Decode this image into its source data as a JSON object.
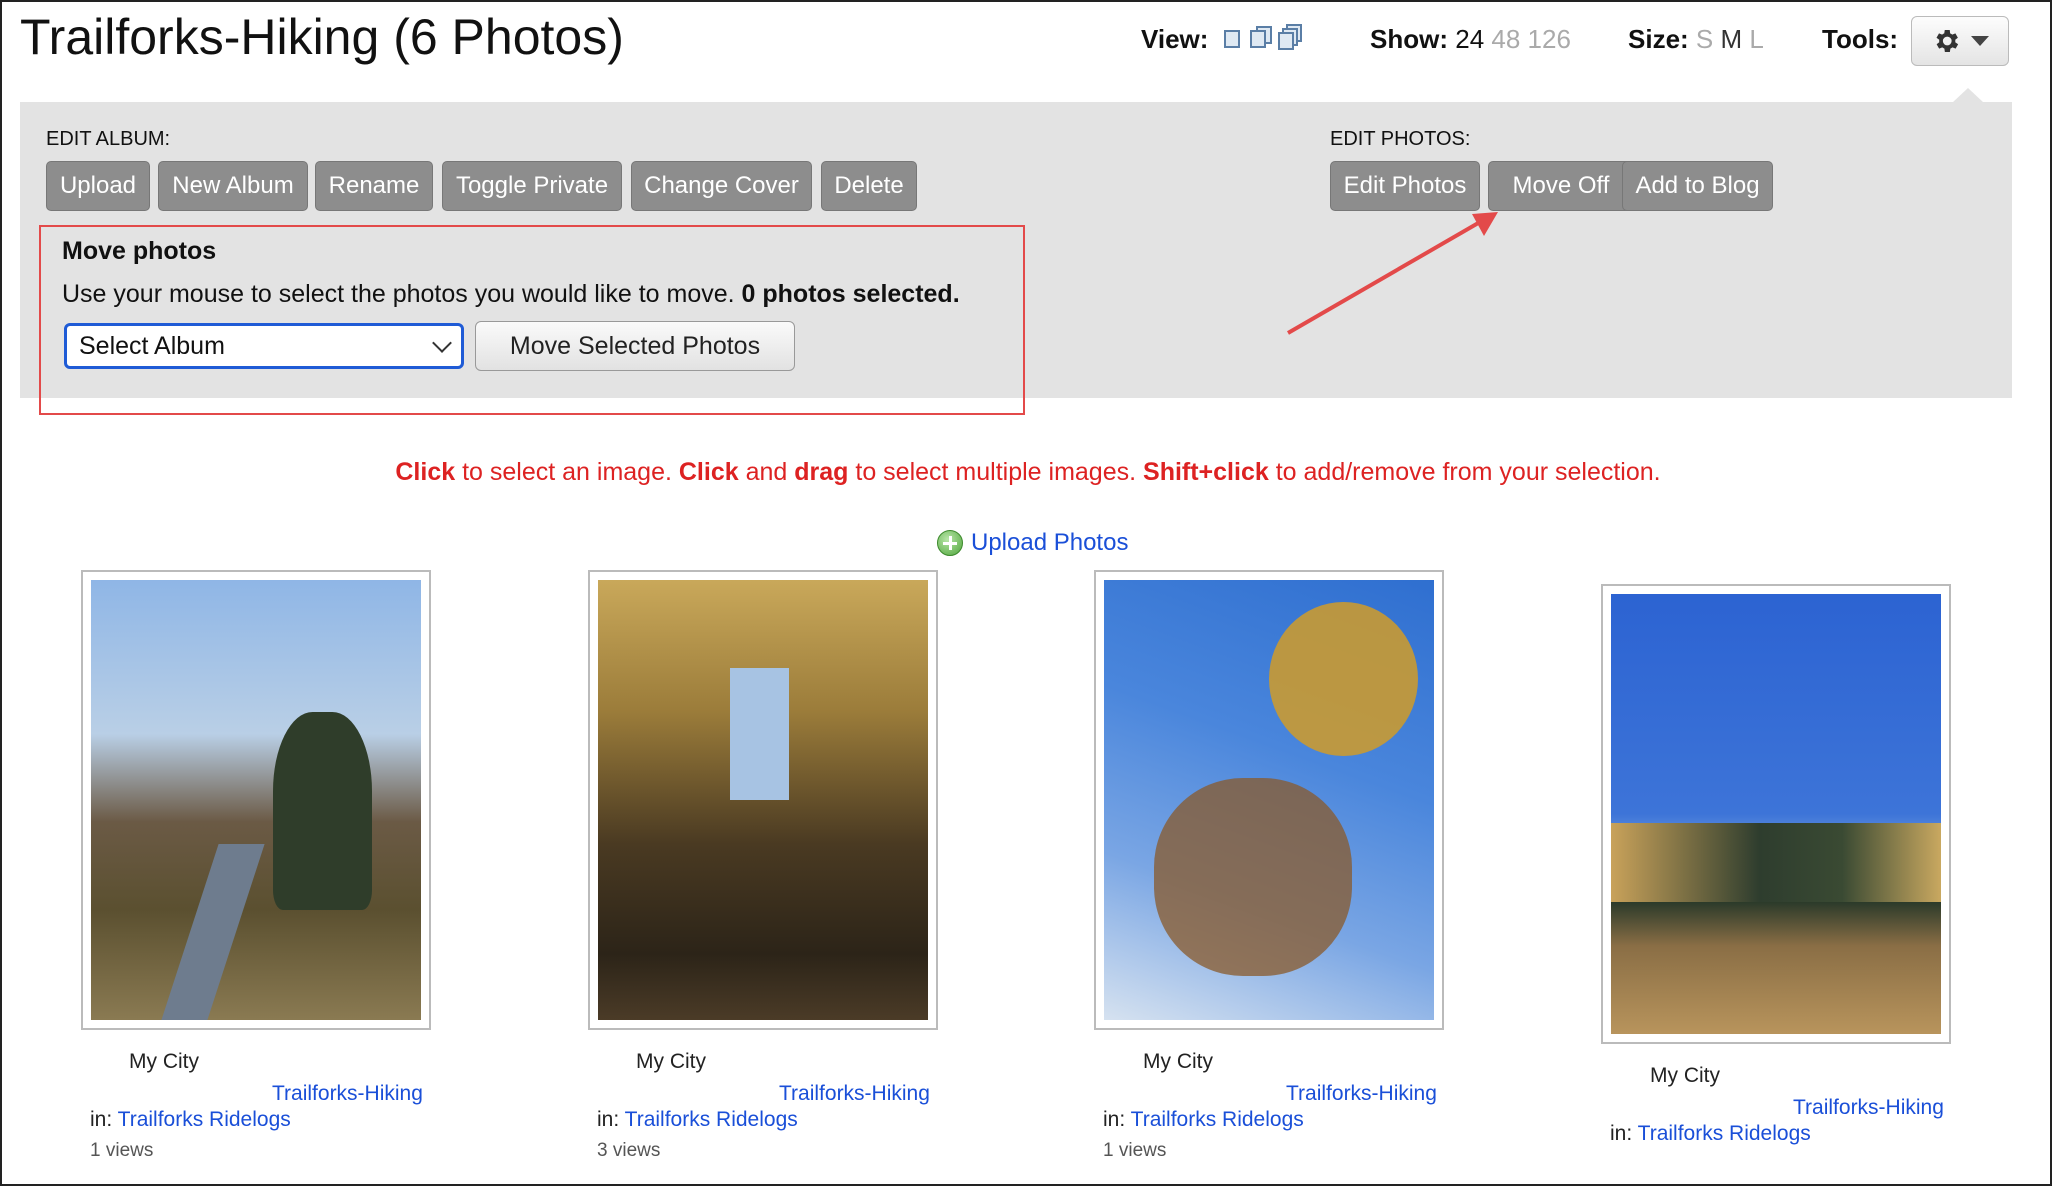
{
  "header": {
    "title": "Trailforks-Hiking (6 Photos)",
    "view_label": "View:",
    "show_label": "Show:",
    "show_options": [
      "24",
      "48",
      "126"
    ],
    "size_label": "Size:",
    "size_options": [
      "S",
      "M",
      "L"
    ],
    "tools_label": "Tools:"
  },
  "edit_album": {
    "label": "EDIT ALBUM:",
    "buttons": [
      "Upload",
      "New Album",
      "Rename",
      "Toggle Private",
      "Change Cover",
      "Delete"
    ]
  },
  "edit_photos": {
    "label": "EDIT PHOTOS:",
    "buttons": [
      "Edit Photos",
      "Move Off",
      "Add to Blog"
    ]
  },
  "move_photos": {
    "title": "Move photos",
    "instruction": "Use your mouse to select the photos you would like to move.",
    "selected_text": "0 photos selected.",
    "select_value": "Select Album",
    "move_button": "Move Selected Photos"
  },
  "help": {
    "click1": "Click",
    "t1": " to select an image. ",
    "click2": "Click",
    "t2": " and ",
    "drag": "drag",
    "t3": " to select multiple images. ",
    "shift": "Shift+click",
    "t4": " to add/remove from your selection."
  },
  "upload_photos": "Upload Photos",
  "photos": [
    {
      "title": "My City",
      "album": "Trailforks-Hiking",
      "in_label": "in:",
      "in_link": "Trailforks Ridelogs",
      "views": "1 views"
    },
    {
      "title": "My City",
      "album": "Trailforks-Hiking",
      "in_label": "in:",
      "in_link": "Trailforks Ridelogs",
      "views": "3 views"
    },
    {
      "title": "My City",
      "album": "Trailforks-Hiking",
      "in_label": "in:",
      "in_link": "Trailforks Ridelogs",
      "views": "1 views"
    },
    {
      "title": "My City",
      "album": "Trailforks-Hiking",
      "in_label": "in:",
      "in_link": "Trailforks Ridelogs"
    }
  ],
  "colors": {
    "accent_red": "#e34a4a",
    "link_blue": "#1a4fd8",
    "button_gray": "#8d8d8d",
    "panel_gray": "#e3e3e3"
  }
}
